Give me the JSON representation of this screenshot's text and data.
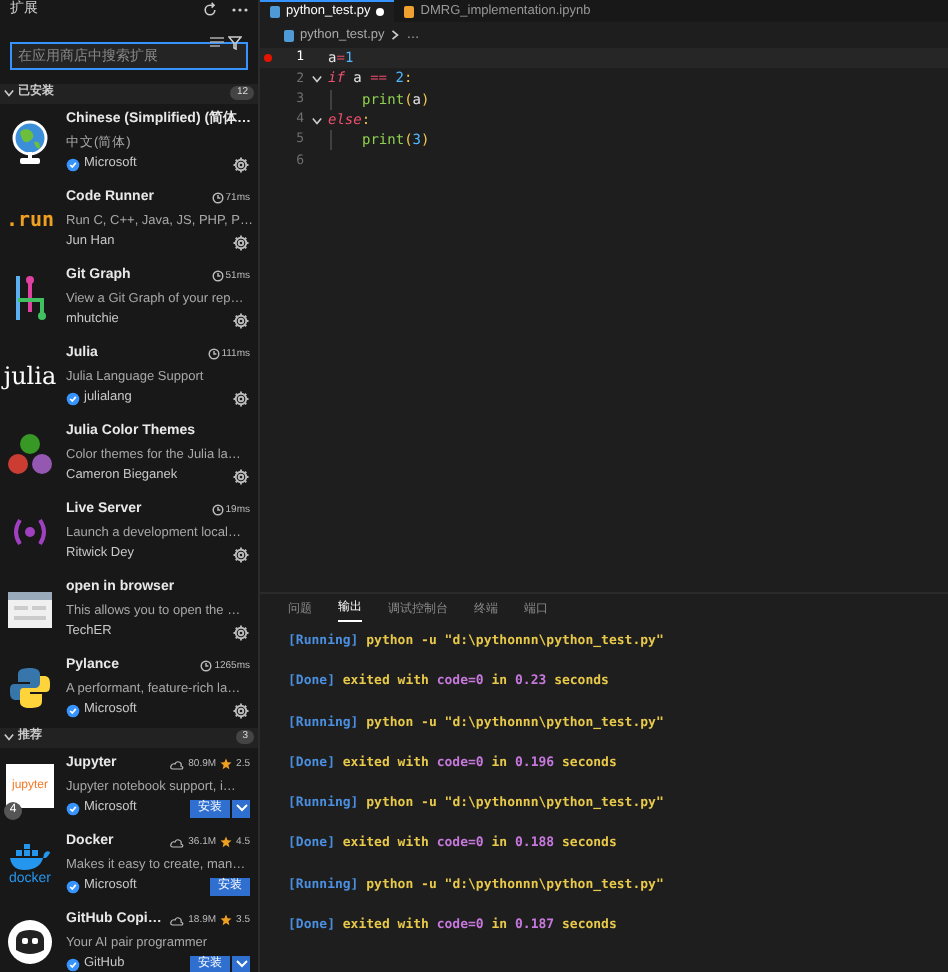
{
  "sidebar": {
    "title": "扩展",
    "search": {
      "placeholder": "在应用商店中搜索扩展"
    },
    "sections": [
      {
        "title": "已安装",
        "count": "12",
        "expanded": true,
        "extensions": [
          {
            "name": "Chinese (Simplified) (简体…",
            "description": "中文(简体)",
            "publisher": "Microsoft",
            "verified": true,
            "kind": "installed"
          },
          {
            "name": "Code Runner",
            "description": "Run C, C++, Java, JS, PHP, P…",
            "publisher": "Jun Han",
            "verified": false,
            "timing": "71ms",
            "logo_text": ".run",
            "kind": "installed"
          },
          {
            "name": "Git Graph",
            "description": "View a Git Graph of your rep…",
            "publisher": "mhutchie",
            "verified": false,
            "timing": "51ms",
            "kind": "installed"
          },
          {
            "name": "Julia",
            "description": "Julia Language Support",
            "publisher": "julialang",
            "verified": true,
            "timing": "111ms",
            "logo_text": "julia",
            "kind": "installed"
          },
          {
            "name": "Julia Color Themes",
            "description": "Color themes for the Julia la…",
            "publisher": "Cameron Bieganek",
            "verified": false,
            "kind": "installed"
          },
          {
            "name": "Live Server",
            "description": "Launch a development local…",
            "publisher": "Ritwick Dey",
            "verified": false,
            "timing": "19ms",
            "kind": "installed"
          },
          {
            "name": "open in browser",
            "description": "This allows you to open the …",
            "publisher": "TechER",
            "verified": false,
            "kind": "installed"
          },
          {
            "name": "Pylance",
            "description": "A performant, feature-rich la…",
            "publisher": "Microsoft",
            "verified": true,
            "timing": "1265ms",
            "kind": "installed"
          }
        ]
      },
      {
        "title": "推荐",
        "count": "3",
        "expanded": true,
        "extensions": [
          {
            "name": "Jupyter",
            "description": "Jupyter notebook support, i…",
            "publisher": "Microsoft",
            "verified": true,
            "downloads": "80.9M",
            "rating": "2.5",
            "logo_text": "jupyter",
            "badge": "4",
            "kind": "recommended",
            "install": "安装",
            "split": true
          },
          {
            "name": "Docker",
            "description": "Makes it easy to create, man…",
            "publisher": "Microsoft",
            "verified": true,
            "downloads": "36.1M",
            "rating": "4.5",
            "logo_text": "docker",
            "kind": "recommended",
            "install": "安装",
            "split": false
          },
          {
            "name": "GitHub Copi…",
            "description": "Your AI pair programmer",
            "publisher": "GitHub",
            "verified": true,
            "downloads": "18.9M",
            "rating": "3.5",
            "kind": "recommended",
            "install": "安装",
            "split": true
          }
        ]
      }
    ]
  },
  "editor": {
    "tabs": [
      {
        "label": "python_test.py",
        "selected": true,
        "modified": true
      },
      {
        "label": "DMRG_implementation.ipynb",
        "selected": false,
        "modified": false
      }
    ],
    "breadcrumb": [
      "python_test.py",
      "…"
    ],
    "lines": [
      {
        "number": "1",
        "current": true,
        "breakpoint": true,
        "tokens": [
          {
            "text": "a",
            "kind": "var"
          },
          {
            "text": "=",
            "kind": "op"
          },
          {
            "text": "1",
            "kind": "number"
          }
        ]
      },
      {
        "number": "2",
        "current": false,
        "breakpoint": false,
        "tokens": [
          {
            "text": "if",
            "kind": "keyword"
          },
          {
            "text": " a ",
            "kind": "var"
          },
          {
            "text": "==",
            "kind": "op"
          },
          {
            "text": " 2",
            "kind": "number"
          },
          {
            "text": ":",
            "kind": "punct"
          }
        ],
        "children": [
          {
            "number": "3",
            "current": false,
            "breakpoint": false,
            "tokens": [
              {
                "text": "print",
                "kind": "func"
              },
              {
                "text": "(",
                "kind": "punct"
              },
              {
                "text": "a",
                "kind": "var"
              },
              {
                "text": ")",
                "kind": "punct"
              }
            ]
          }
        ]
      },
      {
        "number": "4",
        "current": false,
        "breakpoint": false,
        "tokens": [
          {
            "text": "else",
            "kind": "keyword"
          },
          {
            "text": ":",
            "kind": "punct"
          }
        ],
        "children": [
          {
            "number": "5",
            "current": false,
            "breakpoint": false,
            "tokens": [
              {
                "text": "print",
                "kind": "func"
              },
              {
                "text": "(",
                "kind": "punct"
              },
              {
                "text": "3",
                "kind": "number"
              },
              {
                "text": ")",
                "kind": "punct"
              }
            ]
          }
        ]
      },
      {
        "number": "6",
        "current": false,
        "breakpoint": false
      }
    ]
  },
  "panel": {
    "tabs": [
      {
        "label": "问题",
        "selected": false
      },
      {
        "label": "输出",
        "selected": true
      },
      {
        "label": "调试控制台",
        "selected": false
      },
      {
        "label": "终端",
        "selected": false
      },
      {
        "label": "端口",
        "selected": false
      }
    ],
    "output": [
      [
        {
          "text": "[Running]",
          "kind": "tag"
        },
        {
          "text": " python -u \"d:\\pythonnn\\python_test.py\"",
          "kind": "text"
        }
      ],
      [
        {
          "text": "[Done]",
          "kind": "tag"
        },
        {
          "text": " exited with ",
          "kind": "text"
        },
        {
          "text": "code=0",
          "kind": "value"
        },
        {
          "text": " in ",
          "kind": "text"
        },
        {
          "text": "0.23",
          "kind": "value"
        },
        {
          "text": " seconds",
          "kind": "text"
        }
      ],
      [
        {
          "text": "[Running]",
          "kind": "tag"
        },
        {
          "text": " python -u \"d:\\pythonnn\\python_test.py\"",
          "kind": "text"
        }
      ],
      [
        {
          "text": "[Done]",
          "kind": "tag"
        },
        {
          "text": " exited with ",
          "kind": "text"
        },
        {
          "text": "code=0",
          "kind": "value"
        },
        {
          "text": " in ",
          "kind": "text"
        },
        {
          "text": "0.196",
          "kind": "value"
        },
        {
          "text": " seconds",
          "kind": "text"
        }
      ],
      [
        {
          "text": "[Running]",
          "kind": "tag"
        },
        {
          "text": " python -u \"d:\\pythonnn\\python_test.py\"",
          "kind": "text"
        }
      ],
      [
        {
          "text": "[Done]",
          "kind": "tag"
        },
        {
          "text": " exited with ",
          "kind": "text"
        },
        {
          "text": "code=0",
          "kind": "value"
        },
        {
          "text": " in ",
          "kind": "text"
        },
        {
          "text": "0.188",
          "kind": "value"
        },
        {
          "text": " seconds",
          "kind": "text"
        }
      ],
      [
        {
          "text": "[Running]",
          "kind": "tag"
        },
        {
          "text": " python -u \"d:\\pythonnn\\python_test.py\"",
          "kind": "text"
        }
      ],
      [
        {
          "text": "[Done]",
          "kind": "tag"
        },
        {
          "text": " exited with ",
          "kind": "text"
        },
        {
          "text": "code=0",
          "kind": "value"
        },
        {
          "text": " in ",
          "kind": "text"
        },
        {
          "text": "0.187",
          "kind": "value"
        },
        {
          "text": " seconds",
          "kind": "text"
        }
      ]
    ]
  }
}
